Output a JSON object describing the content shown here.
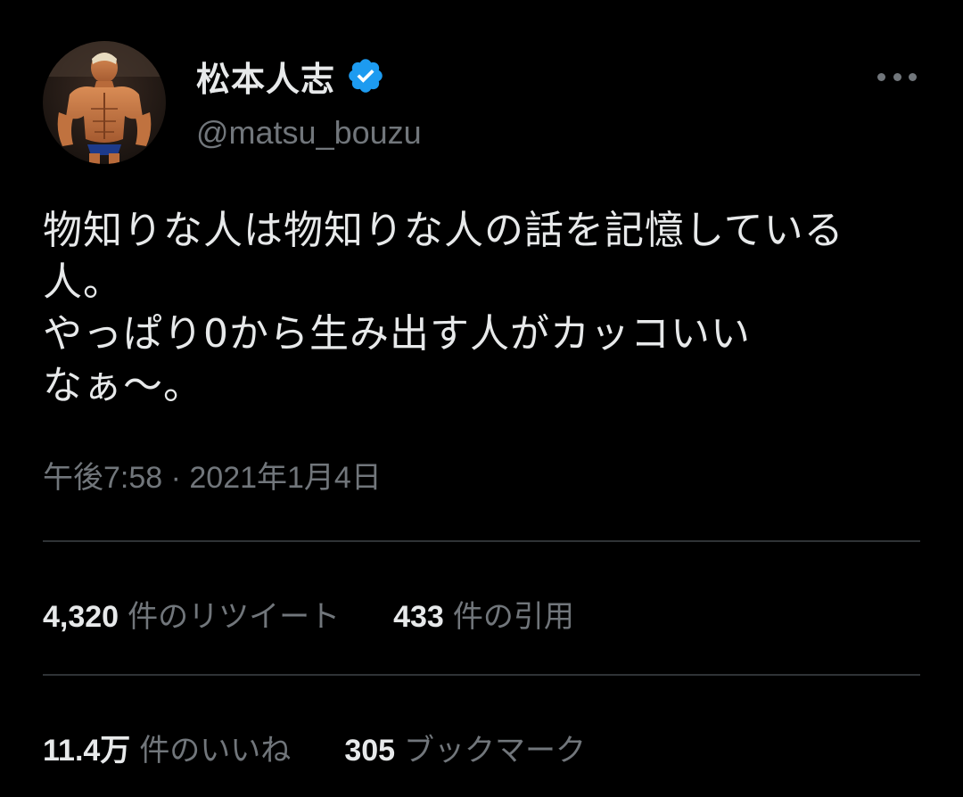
{
  "user": {
    "display_name": "松本人志",
    "handle": "@matsu_bouzu",
    "verified_color": "#1d9bf0"
  },
  "tweet": {
    "text": "物知りな人は物知りな人の話を記憶している\n人。\nやっぱり0から生み出す人がカッコいい\nなぁ〜。",
    "timestamp": "午後7:58 · 2021年1月4日"
  },
  "stats": {
    "retweets": {
      "count": "4,320",
      "label": "件のリツイート"
    },
    "quotes": {
      "count": "433",
      "label": "件の引用"
    },
    "likes": {
      "count": "11.4万",
      "label": "件のいいね"
    },
    "bookmarks": {
      "count": "305",
      "label": "ブックマーク"
    }
  },
  "icons": {
    "verified": "verified-badge-icon",
    "more": "more-options-icon"
  }
}
